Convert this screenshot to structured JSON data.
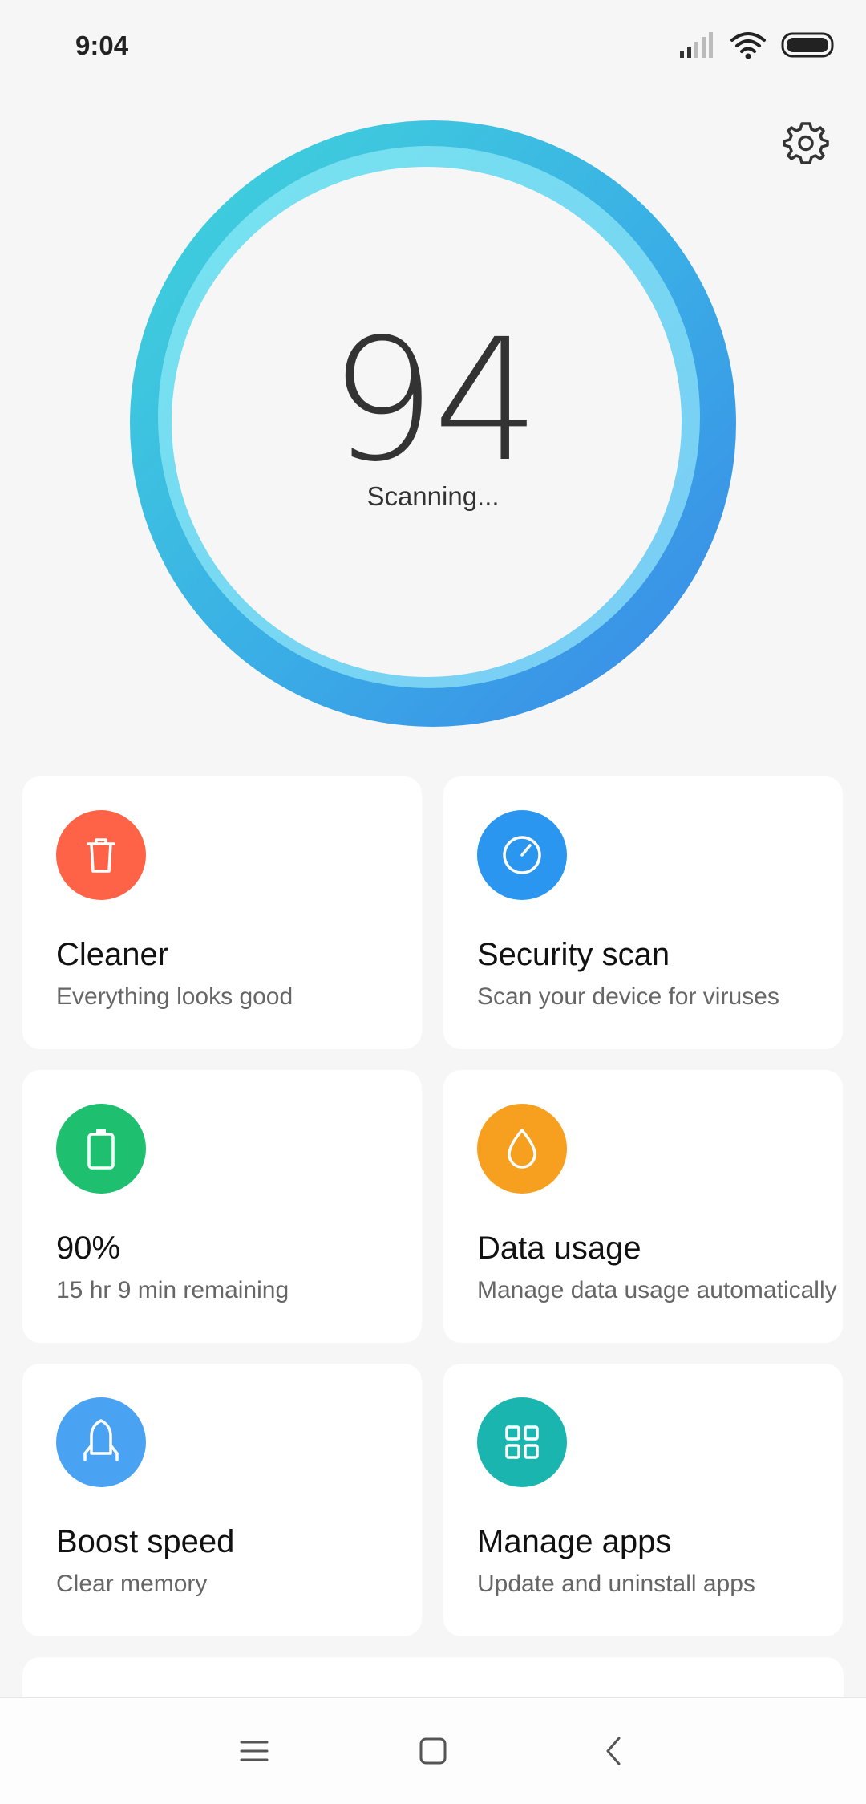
{
  "status_bar": {
    "time": "9:04"
  },
  "scan": {
    "score": "94",
    "status": "Scanning..."
  },
  "cards": [
    {
      "title": "Cleaner",
      "subtitle": "Everything looks good",
      "icon": "trash-icon",
      "color": "#ff6347"
    },
    {
      "title": "Security scan",
      "subtitle": "Scan your device for viruses",
      "icon": "gauge-icon",
      "color": "#2b96f0"
    },
    {
      "title": "90%",
      "subtitle": "15 hr 9 min  remaining",
      "icon": "battery-icon",
      "color": "#1ec070"
    },
    {
      "title": "Data usage",
      "subtitle": "Manage data usage automatically",
      "icon": "drop-icon",
      "color": "#f7a020"
    },
    {
      "title": "Boost speed",
      "subtitle": "Clear memory",
      "icon": "rocket-icon",
      "color": "#4aa3f2"
    },
    {
      "title": "Manage apps",
      "subtitle": "Update and uninstall apps",
      "icon": "grid-icon",
      "color": "#1bb5b0"
    }
  ],
  "colors": {
    "ring_start": "#3fd3dc",
    "ring_end": "#3b8ee8",
    "background": "#f6f6f6"
  }
}
